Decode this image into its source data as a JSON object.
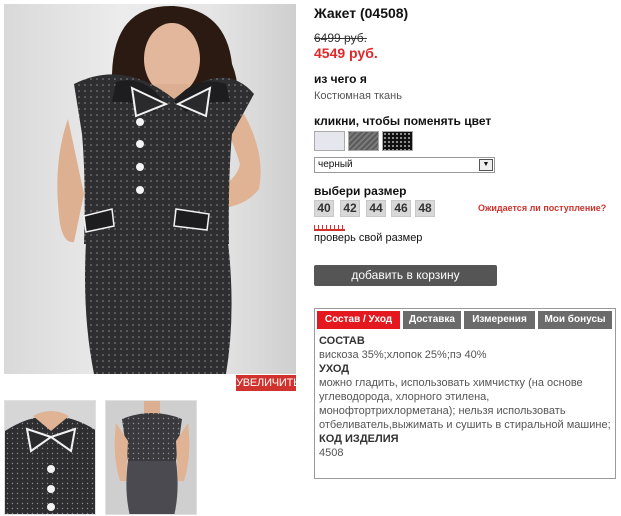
{
  "product": {
    "title": "Жакет (04508)",
    "old_price": "6499 руб.",
    "new_price": "4549 руб."
  },
  "gallery": {
    "zoom_label": "УВЕЛИЧИТЬ"
  },
  "material": {
    "label": "из чего я",
    "value": "Костюмная ткань"
  },
  "color": {
    "label": "кликни, чтобы поменять цвет",
    "selected": "черный"
  },
  "size": {
    "label": "выбери размер",
    "options": [
      "40",
      "42",
      "44",
      "46",
      "48"
    ],
    "expected_link": "Ожидается ли поступление?",
    "check_link": "проверь свой размер"
  },
  "cart": {
    "button_label": "добавить в корзину"
  },
  "tabs": {
    "items": [
      "Состав / Уход",
      "Доставка",
      "Измерения",
      "Мои бонусы"
    ],
    "active_index": 0
  },
  "details": {
    "composition_heading": "СОСТАВ",
    "composition": "вискоза 35%;хлопок 25%;пэ 40%",
    "care_heading": "УХОД",
    "care": "можно гладить, использовать химчистку (на основе углеводорода, хлорного этилена, монофтортрихлорметана); нельзя использовать отбеливатель,выжимать и сушить в стиральной машине;",
    "code_heading": "КОД ИЗДЕЛИЯ",
    "code": "4508"
  },
  "colors": {
    "accent": "#e3191f",
    "zoom": "#d0332d",
    "cart_button": "#555555",
    "tab_inactive": "#6b6b6b"
  }
}
